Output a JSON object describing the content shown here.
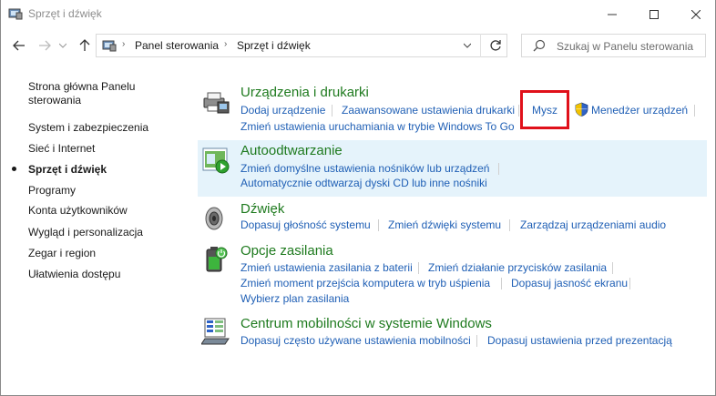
{
  "window": {
    "title": "Sprzęt i dźwięk",
    "minimize_icon": "minimize-icon",
    "maximize_icon": "maximize-icon",
    "close_icon": "close-icon"
  },
  "address": {
    "breadcrumbs": [
      "Panel sterowania",
      "Sprzęt i dźwięk"
    ],
    "separator": "›"
  },
  "search": {
    "placeholder": "Szukaj w Panelu sterowania"
  },
  "sidebar": {
    "items": [
      {
        "label": "Strona główna Panelu sterowania",
        "line1": "Strona główna Panelu",
        "line2": "sterowania"
      },
      {
        "label": "System i zabezpieczenia"
      },
      {
        "label": "Sieć i Internet"
      },
      {
        "label": "Sprzęt i dźwięk",
        "active": true
      },
      {
        "label": "Programy"
      },
      {
        "label": "Konta użytkowników"
      },
      {
        "label": "Wygląd i personalizacja"
      },
      {
        "label": "Zegar i region"
      },
      {
        "label": "Ułatwienia dostępu"
      }
    ]
  },
  "categories": {
    "devices": {
      "title": "Urządzenia i drukarki",
      "links": [
        "Dodaj urządzenie",
        "Zaawansowane ustawienia drukarki",
        "Mysz",
        "Menedżer urządzeń",
        "Zmień ustawienia uruchamiania w trybie Windows To Go"
      ]
    },
    "autoplay": {
      "title": "Autoodtwarzanie",
      "links": [
        "Zmień domyślne ustawienia nośników lub urządzeń",
        "Automatycznie odtwarzaj dyski CD lub inne nośniki"
      ]
    },
    "sound": {
      "title": "Dźwięk",
      "links": [
        "Dopasuj głośność systemu",
        "Zmień dźwięki systemu",
        "Zarządzaj urządzeniami audio"
      ]
    },
    "power": {
      "title": "Opcje zasilania",
      "links": [
        "Zmień ustawienia zasilania z baterii",
        "Zmień działanie przycisków zasilania",
        "Zmień moment przejścia komputera w tryb uśpienia",
        "Dopasuj jasność ekranu",
        "Wybierz plan zasilania"
      ]
    },
    "mobility": {
      "title": "Centrum mobilności w systemie Windows",
      "links": [
        "Dopasuj często używane ustawienia mobilności",
        "Dopasuj ustawienia przed prezentacją"
      ]
    }
  },
  "colors": {
    "category_title": "#1e7a1e",
    "link": "#1f5fb5",
    "highlight_bg": "#e5f3fb",
    "annotation_box": "#e0101a"
  }
}
